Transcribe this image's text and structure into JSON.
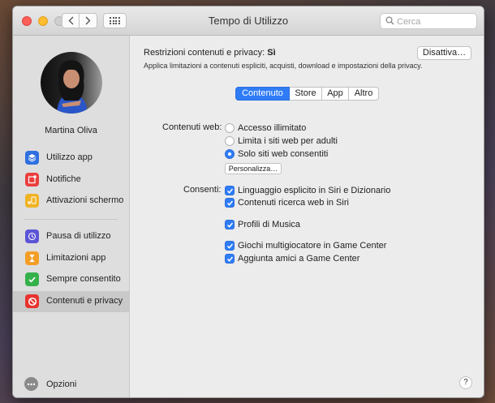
{
  "window": {
    "title": "Tempo di Utilizzo"
  },
  "search": {
    "placeholder": "Cerca"
  },
  "sidebar": {
    "user_name": "Martina Oliva",
    "items": [
      {
        "label": "Utilizzo app",
        "icon": "layers-icon",
        "color": "#2f6fe0"
      },
      {
        "label": "Notifiche",
        "icon": "notification-icon",
        "color": "#ea3f3f"
      },
      {
        "label": "Attivazioni schermo",
        "icon": "pickup-icon",
        "color": "#f0b323"
      },
      {
        "label": "Pausa di utilizzo",
        "icon": "downtime-icon",
        "color": "#5c55d6"
      },
      {
        "label": "Limitazioni app",
        "icon": "hourglass-icon",
        "color": "#f59e27"
      },
      {
        "label": "Sempre consentito",
        "icon": "checkmark-icon",
        "color": "#34b14a"
      },
      {
        "label": "Contenuti e privacy",
        "icon": "restriction-icon",
        "color": "#e8332e"
      }
    ],
    "options_label": "Opzioni"
  },
  "main": {
    "restrictions_label": "Restrizioni contenuti e privacy:",
    "restrictions_status": "Sì",
    "restrictions_desc": "Applica limitazioni a contenuti espliciti, acquisti, download e impostazioni della privacy.",
    "disable_button": "Disattiva…",
    "tabs": [
      "Contenuto",
      "Store",
      "App",
      "Altro"
    ],
    "web_content_label": "Contenuti web:",
    "web_options": [
      "Accesso illimitato",
      "Limita i siti web per adulti",
      "Solo siti web consentiti"
    ],
    "web_selected": "Solo siti web consentiti",
    "customize_button": "Personalizza…",
    "allow_label": "Consenti:",
    "allow_items": [
      "Linguaggio esplicito in Siri e Dizionario",
      "Contenuti ricerca web in Siri",
      "Profili di Musica",
      "Giochi multigiocatore in Game Center",
      "Aggiunta amici a Game Center"
    ],
    "help_label": "?"
  },
  "colors": {
    "accent": "#2f7cf6"
  }
}
